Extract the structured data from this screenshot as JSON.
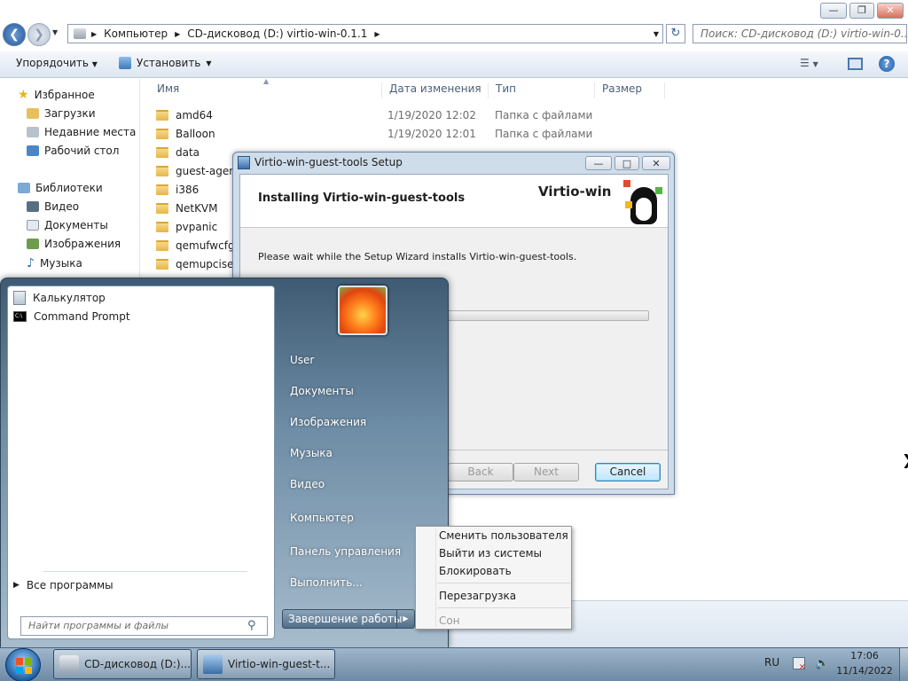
{
  "explorer": {
    "breadcrumb": [
      "Компьютер",
      "CD-дисковод (D:) virtio-win-0.1.1"
    ],
    "search_placeholder": "Поиск: CD-дисковод (D:) virtio-win-0...",
    "toolbar": {
      "organize": "Упорядочить",
      "install": "Установить"
    },
    "nav": {
      "favorites": "Избранное",
      "downloads": "Загрузки",
      "recent": "Недавние места",
      "desktop": "Рабочий стол",
      "libraries": "Библиотеки",
      "video": "Видео",
      "documents": "Документы",
      "pictures": "Изображения",
      "music": "Музыка"
    },
    "columns": {
      "name": "Имя",
      "date": "Дата изменения",
      "type": "Тип",
      "size": "Размер"
    },
    "files": [
      {
        "name": "amd64",
        "date": "1/19/2020 12:02",
        "type": "Папка с файлами"
      },
      {
        "name": "Balloon",
        "date": "1/19/2020 12:01",
        "type": "Папка с файлами"
      },
      {
        "name": "data",
        "date": "",
        "type": ""
      },
      {
        "name": "guest-agent",
        "date": "",
        "type": ""
      },
      {
        "name": "i386",
        "date": "",
        "type": ""
      },
      {
        "name": "NetKVM",
        "date": "",
        "type": ""
      },
      {
        "name": "pvpanic",
        "date": "",
        "type": ""
      },
      {
        "name": "qemufwcfg",
        "date": "",
        "type": ""
      },
      {
        "name": "qemupciserial",
        "date": "",
        "type": ""
      }
    ]
  },
  "setup": {
    "title": "Virtio-win-guest-tools Setup",
    "heading": "Installing Virtio-win-guest-tools",
    "brand": "Virtio-win",
    "message": "Please wait while the Setup Wizard installs Virtio-win-guest-tools.",
    "progress": 0.0,
    "buttons": {
      "back": "Back",
      "next": "Next",
      "cancel": "Cancel"
    }
  },
  "startmenu": {
    "programs": [
      "Калькулятор",
      "Command Prompt"
    ],
    "all_programs": "Все программы",
    "search_placeholder": "Найти программы и файлы",
    "right": {
      "user": "User",
      "documents": "Документы",
      "pictures": "Изображения",
      "music": "Музыка",
      "video": "Видео",
      "computer": "Компьютер",
      "control_panel": "Панель управления",
      "run": "Выполнить..."
    },
    "shutdown": "Завершение работы"
  },
  "context_menu": {
    "switch_user": "Сменить пользователя",
    "logoff": "Выйти из системы",
    "lock": "Блокировать",
    "restart": "Перезагрузка",
    "sleep": "Сон"
  },
  "taskbar": {
    "items": [
      "CD-дисковод (D:)...",
      "Virtio-win-guest-t..."
    ],
    "lang": "RU",
    "time": "17:06",
    "date": "11/14/2022"
  }
}
